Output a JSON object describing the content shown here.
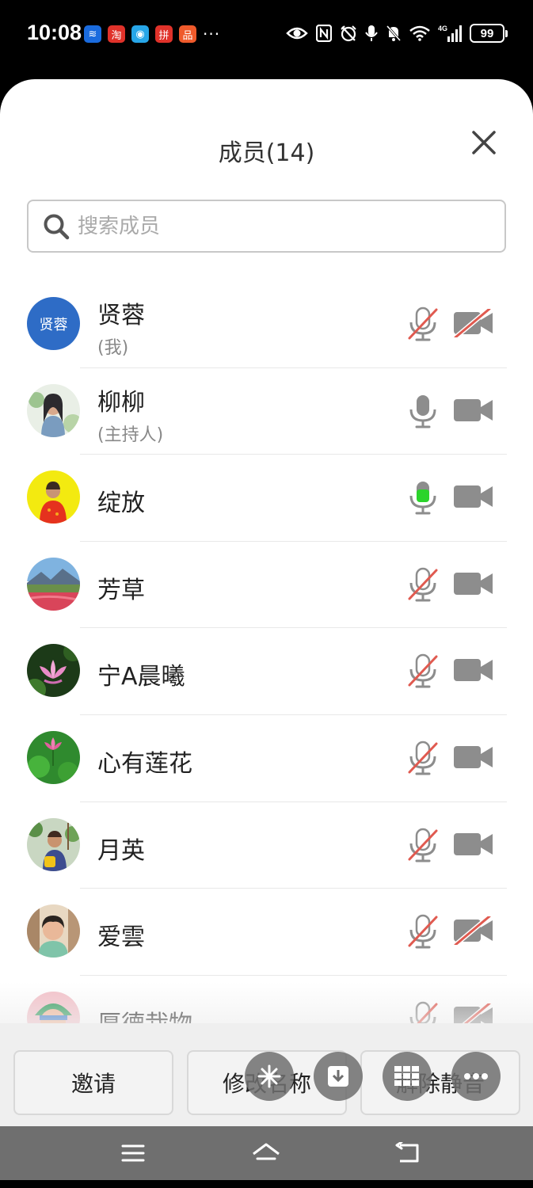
{
  "status_bar": {
    "time": "10:08",
    "battery": "99",
    "notif_icons": [
      {
        "name": "app-notification-icon-1",
        "color": "#1a6bde",
        "glyph": "≋"
      },
      {
        "name": "app-notification-icon-2",
        "color": "#e0322a",
        "glyph": "淘"
      },
      {
        "name": "app-notification-icon-3",
        "color": "#27a6e8",
        "glyph": "◉"
      },
      {
        "name": "app-notification-icon-4",
        "color": "#e0322a",
        "glyph": "拼"
      },
      {
        "name": "app-notification-icon-5",
        "color": "#ef5a2b",
        "glyph": "品"
      }
    ],
    "notif_more": "···",
    "signal_label": "4G"
  },
  "sheet": {
    "title": "成员(14)"
  },
  "search": {
    "placeholder": "搜索成员"
  },
  "members": [
    {
      "name": "贤蓉",
      "sub": "(我)",
      "avatar_text": "贤蓉",
      "avatar_color": "#2e6cc6",
      "avatar_style": "text",
      "mic": "muted",
      "cam": "off"
    },
    {
      "name": "柳柳",
      "sub": "(主持人)",
      "avatar_style": "photo-woman",
      "mic": "on",
      "cam": "on"
    },
    {
      "name": "绽放",
      "sub": "",
      "avatar_style": "photo-yellow",
      "mic": "speaking",
      "cam": "on"
    },
    {
      "name": "芳草",
      "sub": "",
      "avatar_style": "photo-landscape",
      "mic": "muted",
      "cam": "on"
    },
    {
      "name": "宁A晨曦",
      "sub": "",
      "avatar_style": "photo-lotus",
      "mic": "muted",
      "cam": "on"
    },
    {
      "name": "心有莲花",
      "sub": "",
      "avatar_style": "photo-lotus-green",
      "mic": "muted",
      "cam": "on"
    },
    {
      "name": "月英",
      "sub": "",
      "avatar_style": "photo-garden",
      "mic": "muted",
      "cam": "on"
    },
    {
      "name": "爱雲",
      "sub": "",
      "avatar_style": "photo-face",
      "mic": "muted",
      "cam": "off"
    },
    {
      "name": "厚德栽物",
      "sub": "",
      "avatar_style": "photo-cartoon",
      "mic": "muted",
      "cam": "off"
    }
  ],
  "bottom_buttons": {
    "invite": "邀请",
    "rename": "修改名称",
    "unmute_all": "解除静音"
  },
  "colors": {
    "muted_red": "#e05a50",
    "icon_gray": "#8d8d8d",
    "speaking_green": "#2bd42b",
    "avatar_blue": "#2e6cc6"
  }
}
